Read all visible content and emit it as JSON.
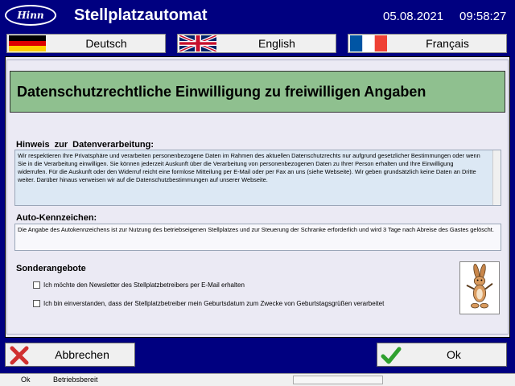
{
  "header": {
    "logo_text": "Hinn",
    "title": "Stellplatzautomat",
    "date": "05.08.2021",
    "time": "09:58:27"
  },
  "languages": [
    {
      "label": "Deutsch",
      "flag": "germany-flag-icon"
    },
    {
      "label": "English",
      "flag": "uk-flag-icon"
    },
    {
      "label": "Français",
      "flag": "france-flag-icon"
    }
  ],
  "consent": {
    "title": "Datenschutzrechtliche Einwilligung zu freiwilligen Angaben",
    "privacy_label": "Hinweis zur Datenverarbeitung:",
    "privacy_text": "Wir respektieren Ihre Privatsphäre und verarbeiten personenbezogene Daten im Rahmen des aktuellen Datenschutzrechts nur aufgrund gesetzlicher Bestimmungen oder wenn Sie in die Verarbeitung einwilligen. Sie können jederzeit Auskunft über die Verarbeitung von personenbezogenen Daten zu Ihrer Person erhalten und Ihre Einwilligung widerrufen. Für die Auskunft oder den Widerruf reicht eine formlose Mitteilung per E-Mail oder per Fax an uns (siehe Webseite). Wir geben grundsätzlich keine Daten an Dritte weiter. Darüber hinaus verweisen wir auf die Datenschutzbestimmungen auf unserer Webseite.",
    "plate_label": "Auto-Kennzeichen:",
    "plate_text": "Die Angabe des Autokennzeichens ist zur Nutzung des betriebseigenen Stellplatzes und zur Steuerung der Schranke erforderlich und wird 3 Tage nach Abreise des Gastes gelöscht.",
    "offers_label": "Sonderangebote",
    "newsletter_text": "Ich möchte den Newsletter des Stellplatzbetreibers per E-Mail erhalten",
    "birthday_text": "Ich bin einverstanden, dass der Stellplatzbetreiber mein Geburtsdatum zum Zwecke von Geburtstagsgrüßen verarbeitet",
    "newsletter_checked": false,
    "birthday_checked": false,
    "mascot_icon": "rabbit-mascot-icon"
  },
  "buttons": {
    "cancel_label": "Abbrechen",
    "ok_label": "Ok"
  },
  "status": {
    "ok": "Ok",
    "text": "Betriebsbereit"
  },
  "colors": {
    "background": "#000080",
    "header_band": "#8fc08f",
    "panel": "#ebeaf4",
    "cancel_x": "#d03030",
    "ok_check": "#2fa02f"
  }
}
